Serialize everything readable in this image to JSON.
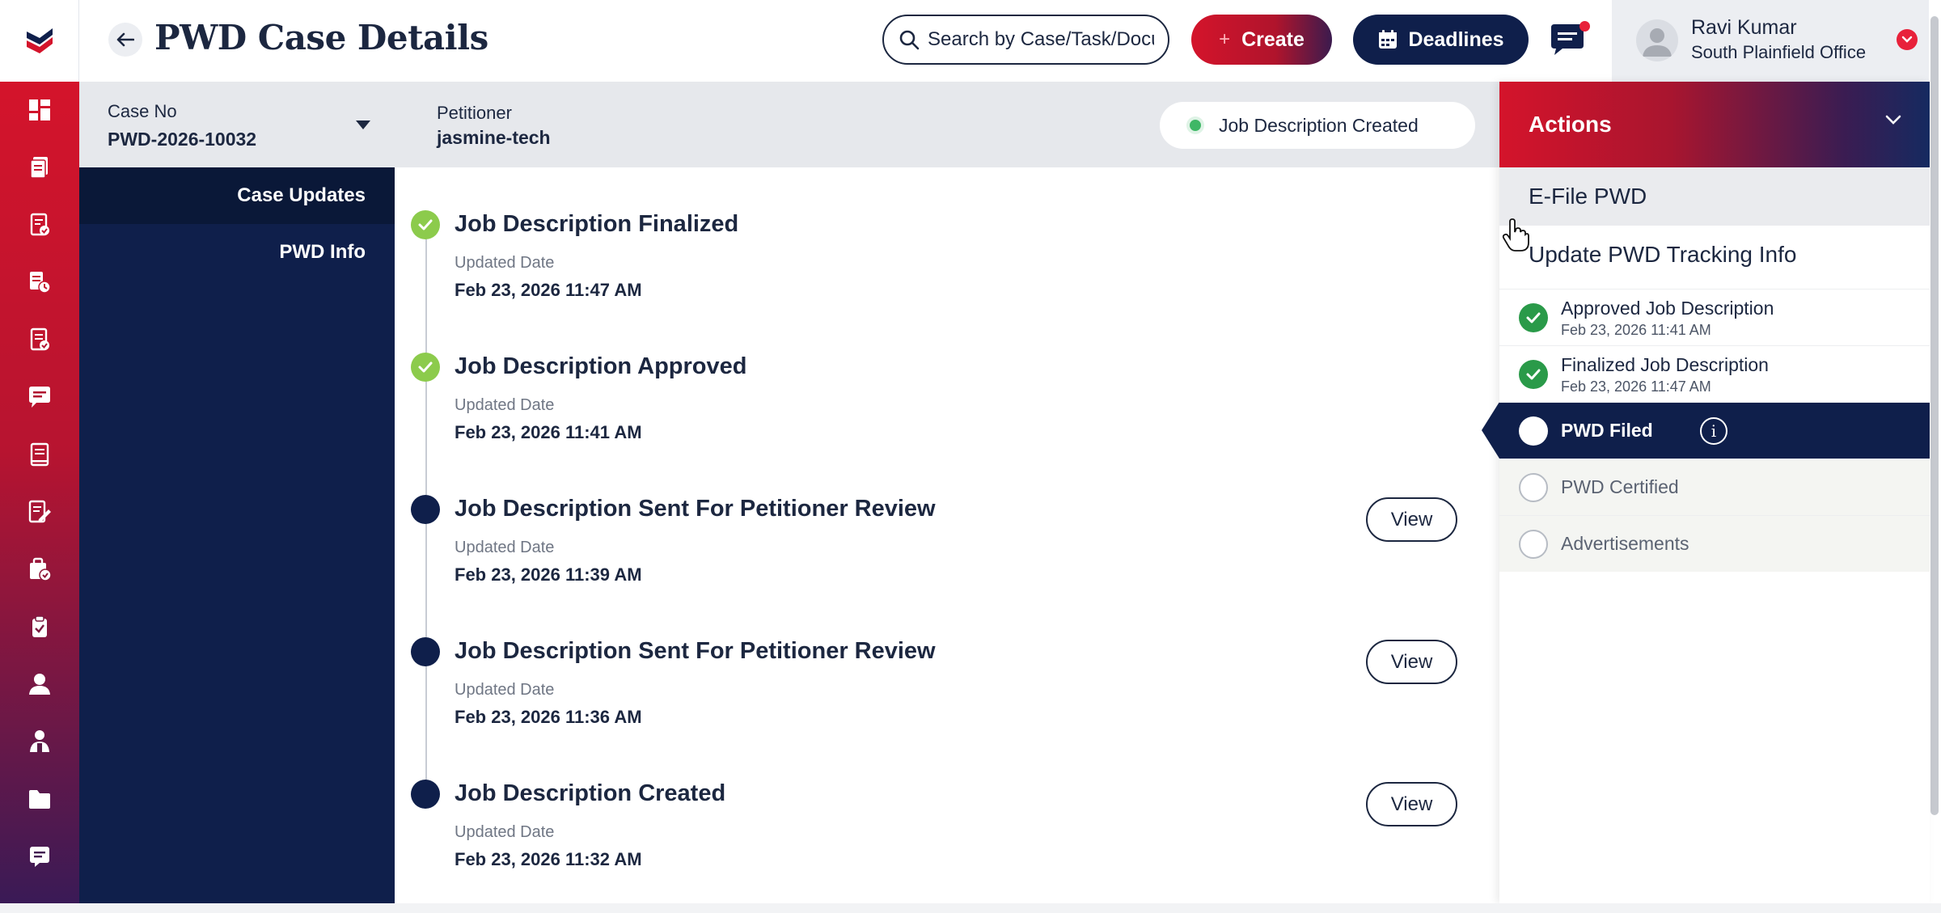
{
  "header": {
    "title": "PWD Case Details",
    "search_placeholder": "Search by Case/Task/Document",
    "create_label": "Create",
    "create_icon": "plus-icon",
    "deadlines_label": "Deadlines",
    "deadlines_icon": "calendar-icon",
    "chat_icon": "chat-icon",
    "user": {
      "name": "Ravi Kumar",
      "office": "South Plainfield Office"
    }
  },
  "rail": {
    "icons": [
      "dashboard-icon",
      "documents-icon",
      "case-file-icon",
      "case-status-icon",
      "checklist-icon",
      "message-icon",
      "book-icon",
      "edit-form-icon",
      "case-approved-icon",
      "clipboard-icon",
      "user-icon",
      "group-icon",
      "folder-icon",
      "notes-icon"
    ]
  },
  "case_bar": {
    "case_no_label": "Case No",
    "case_no": "PWD-2026-10032",
    "petitioner_label": "Petitioner",
    "petitioner": "jasmine-tech",
    "status": "Job Description Created"
  },
  "subnav": {
    "items": [
      {
        "label": "Case Updates",
        "active": true
      },
      {
        "label": "PWD Info",
        "active": false
      }
    ]
  },
  "timeline": {
    "items": [
      {
        "title": "Job Description Finalized",
        "date_label": "Updated Date",
        "date": "Feb 23, 2026 11:47 AM",
        "status": "completed",
        "action": ""
      },
      {
        "title": "Job Description Approved",
        "date_label": "Updated Date",
        "date": "Feb 23, 2026 11:41 AM",
        "status": "completed",
        "action": ""
      },
      {
        "title": "Job Description Sent For Petitioner Review",
        "date_label": "Updated Date",
        "date": "Feb 23, 2026 11:39 AM",
        "status": "pending",
        "action": "View"
      },
      {
        "title": "Job Description Sent For Petitioner Review",
        "date_label": "Updated Date",
        "date": "Feb 23, 2026 11:36 AM",
        "status": "pending",
        "action": "View"
      },
      {
        "title": "Job Description Created",
        "date_label": "Updated Date",
        "date": "Feb 23, 2026 11:32 AM",
        "status": "pending",
        "action": "View"
      }
    ]
  },
  "actions": {
    "title": "Actions",
    "items": [
      "E-File PWD",
      "Update PWD Tracking Info"
    ],
    "steps": [
      {
        "title": "Approved Job Description",
        "date": "Feb 23, 2026 11:41 AM",
        "state": "done"
      },
      {
        "title": "Finalized Job Description",
        "date": "Feb 23, 2026 11:47 AM",
        "state": "done"
      },
      {
        "title": "PWD Filed",
        "date": "",
        "state": "current"
      },
      {
        "title": "PWD Certified",
        "date": "",
        "state": "todo"
      },
      {
        "title": "Advertisements",
        "date": "",
        "state": "todo"
      }
    ]
  },
  "colors": {
    "brand_red": "#d4142b",
    "navy": "#0f1f4b",
    "success_green": "#2a9a49",
    "timeline_green": "#8ccb4c",
    "status_dot": "#3fb766"
  }
}
